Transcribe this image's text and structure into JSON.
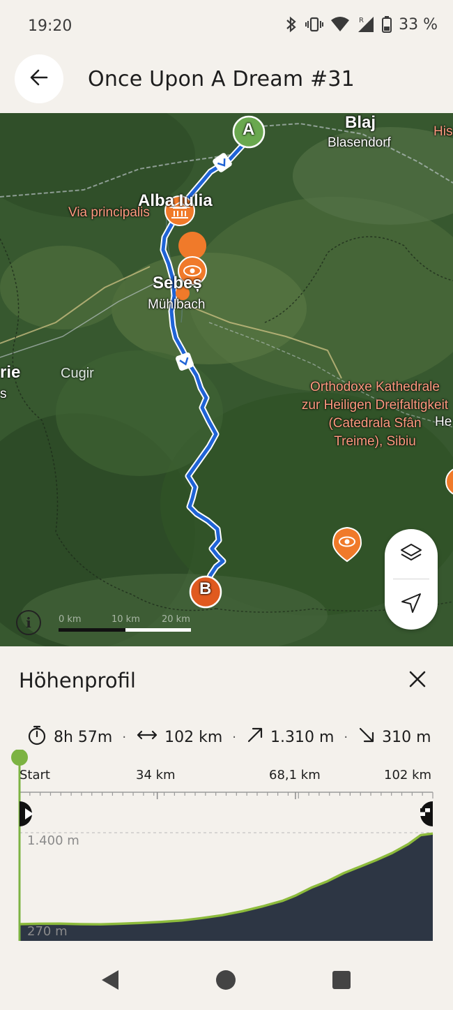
{
  "status_bar": {
    "time": "19:20",
    "battery_text": "33 %",
    "icons": [
      "bluetooth-icon",
      "vibrate-icon",
      "wifi-icon",
      "signal-roaming-icon",
      "battery-icon"
    ]
  },
  "header": {
    "back_icon": "arrow-left-icon",
    "title": "Once Upon A Dream #31"
  },
  "map": {
    "labels": {
      "blaj": "Blaj",
      "blasendorf": "Blasendorf",
      "his": "His",
      "alba_iulia": "Alba Iulia",
      "via_principalis": "Via principalis",
      "sebes": "Sebeș",
      "muhlbach": "Mühlbach",
      "rie": "rie",
      "s": "s",
      "cugir": "Cugir",
      "cathedral": [
        "Orthodoxe Kathedrale",
        "zur Heiligen Dreifaltigkeit",
        "(Catedrala Sfân",
        "Treime), Sibiu"
      ],
      "he": "He"
    },
    "start_marker": "A",
    "end_marker": "B",
    "scale_labels": [
      "0 km",
      "10 km",
      "20 km"
    ],
    "info_label": "i",
    "controls": [
      "layers-icon",
      "locate-icon"
    ],
    "colors": {
      "route": "#1f63d6",
      "start_marker": "#6aa84f",
      "end_marker": "#e05a1f",
      "poi": "#f07a2a"
    }
  },
  "elevation": {
    "title": "Höhenprofil",
    "stats": {
      "duration": "8h 57m",
      "distance": "102 km",
      "ascent": "1.310 m",
      "descent": "310 m"
    },
    "x_ticks": [
      "Start",
      "34 km",
      "68,1 km",
      "102 km"
    ],
    "y_labels": {
      "max": "1.400 m",
      "min": "270 m"
    },
    "profile_km_m": [
      [
        0,
        270
      ],
      [
        5,
        275
      ],
      [
        10,
        277
      ],
      [
        15,
        270
      ],
      [
        20,
        268
      ],
      [
        25,
        275
      ],
      [
        30,
        285
      ],
      [
        35,
        298
      ],
      [
        40,
        315
      ],
      [
        45,
        345
      ],
      [
        50,
        380
      ],
      [
        55,
        430
      ],
      [
        60,
        490
      ],
      [
        65,
        560
      ],
      [
        68,
        620
      ],
      [
        72,
        720
      ],
      [
        76,
        800
      ],
      [
        80,
        900
      ],
      [
        84,
        980
      ],
      [
        88,
        1060
      ],
      [
        92,
        1150
      ],
      [
        96,
        1260
      ],
      [
        99,
        1370
      ],
      [
        102,
        1390
      ]
    ],
    "colors": {
      "fill": "#2d3644",
      "line": "#8dbb3c",
      "marker": "#7cb342"
    }
  },
  "navbar": {
    "icons": [
      "back-triangle-icon",
      "home-circle-icon",
      "recents-square-icon"
    ]
  }
}
